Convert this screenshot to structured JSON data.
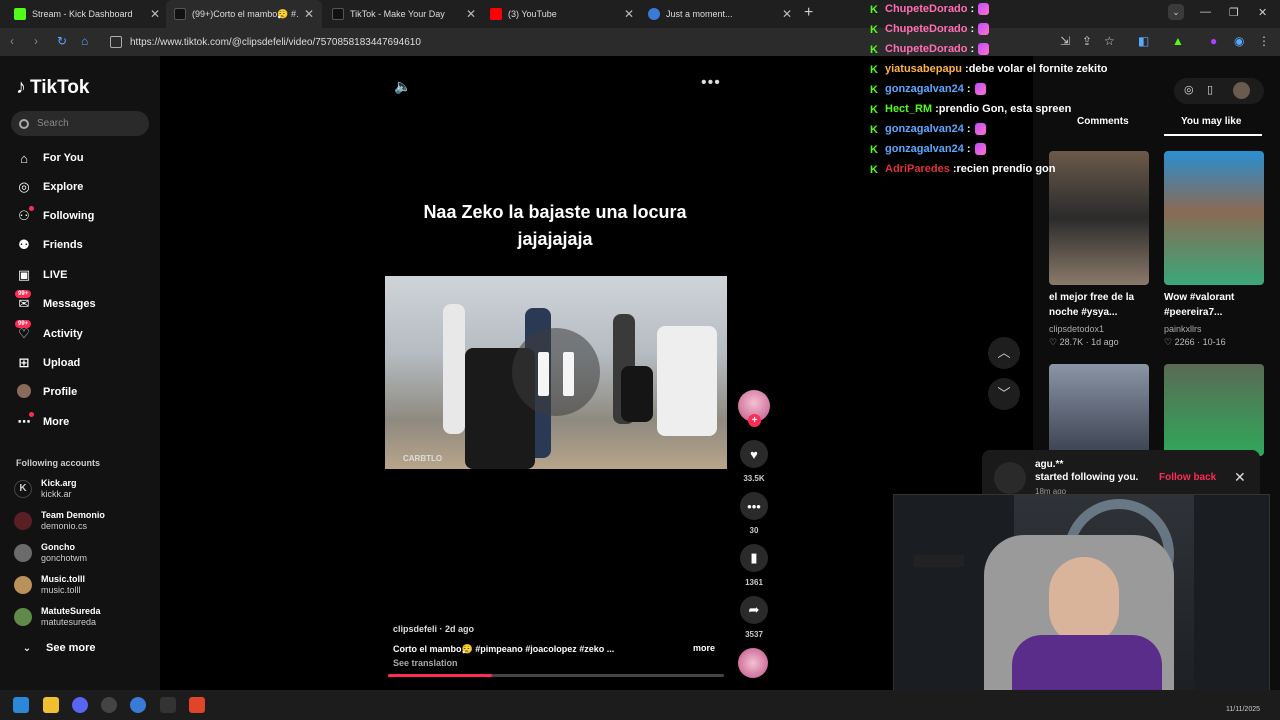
{
  "browser": {
    "tabs": [
      {
        "title": "Stream - Kick Dashboard",
        "color": "#53fc18"
      },
      {
        "title": "(99+)Corto el mambo😮‍💨 #…",
        "color": "#111111"
      },
      {
        "title": "TikTok - Make Your Day",
        "color": "#111111"
      },
      {
        "title": "(3) YouTube",
        "color": "#ff0000"
      },
      {
        "title": "Just a moment...",
        "color": "#3a7bd5"
      }
    ],
    "url": "https://www.tiktok.com/@clipsdefeli/video/7570858183447694610"
  },
  "tiktok": {
    "logo": "TikTok",
    "search_placeholder": "Search",
    "nav": [
      {
        "label": "For You",
        "icon": "home-icon"
      },
      {
        "label": "Explore",
        "icon": "compass-icon"
      },
      {
        "label": "Following",
        "icon": "following-icon"
      },
      {
        "label": "Friends",
        "icon": "friends-icon"
      },
      {
        "label": "LIVE",
        "icon": "live-icon"
      },
      {
        "label": "Messages",
        "icon": "messages-icon",
        "badge": "99+"
      },
      {
        "label": "Activity",
        "icon": "activity-icon",
        "badge": "99+"
      },
      {
        "label": "Upload",
        "icon": "upload-icon"
      },
      {
        "label": "Profile",
        "icon": "avatar"
      },
      {
        "label": "More",
        "icon": "more-icon"
      }
    ],
    "following_header": "Following accounts",
    "accounts": [
      {
        "name": "Kick.arg",
        "handle": "kickk.ar"
      },
      {
        "name": "Team Demonio",
        "handle": "demonio.cs"
      },
      {
        "name": "Goncho",
        "handle": "gonchotwm"
      },
      {
        "name": "Music.tolll",
        "handle": "music.tolll"
      },
      {
        "name": "MatuteSureda",
        "handle": "matutesureda"
      }
    ],
    "see_more": "See more",
    "video": {
      "caption": "Naa Zeko la bajaste una locura jajajajaja",
      "watermark": "CARBTLO",
      "author_line": "clipsdefeli · 2d ago",
      "description": "Corto el mambo😮‍💨 #pimpeano  #joacolopez  #zeko ...",
      "more": "more",
      "see_translation": "See translation",
      "progress": 0.31,
      "likes": "33.5K",
      "comments": "30",
      "saves": "1361",
      "shares": "3537"
    }
  },
  "right_panel": {
    "tabs": [
      "Comments",
      "You may like"
    ],
    "active_tab": "You may like",
    "cards": [
      {
        "title": "el mejor free de la noche #ysya...",
        "user": "clipsdetodox1",
        "likes": "28.7K",
        "date": "1d ago"
      },
      {
        "title": "Wow #valorant #peereira7...",
        "user": "painkxllrs",
        "likes": "2266",
        "date": "10-16"
      }
    ]
  },
  "chat": [
    {
      "user": "ChupeteDorado",
      "color": "#ff6eb4",
      "msg": "",
      "emote": true
    },
    {
      "user": "ChupeteDorado",
      "color": "#ff6eb4",
      "msg": "",
      "emote": true
    },
    {
      "user": "ChupeteDorado",
      "color": "#ff6eb4",
      "msg": "",
      "emote": true
    },
    {
      "user": "yiatusabepapu",
      "color": "#ffb347",
      "msg": "debe volar el fornite zekito",
      "emote": false
    },
    {
      "user": "gonzagalvan24",
      "color": "#5aa9ff",
      "msg": "",
      "emote": true
    },
    {
      "user": "Hect_RM",
      "color": "#53fc18",
      "msg": "prendio Gon, esta spreen",
      "emote": false
    },
    {
      "user": "gonzagalvan24",
      "color": "#5aa9ff",
      "msg": "",
      "emote": true
    },
    {
      "user": "gonzagalvan24",
      "color": "#5aa9ff",
      "msg": "",
      "emote": true
    },
    {
      "user": "AdriParedes",
      "color": "#e0323a",
      "msg": "recien prendio gon",
      "emote": false
    }
  ],
  "notification": {
    "user": "agu.**",
    "text": "started following you.",
    "time": "18m ago",
    "action": "Follow back"
  },
  "taskbar": {
    "date": "11/11/2025"
  }
}
